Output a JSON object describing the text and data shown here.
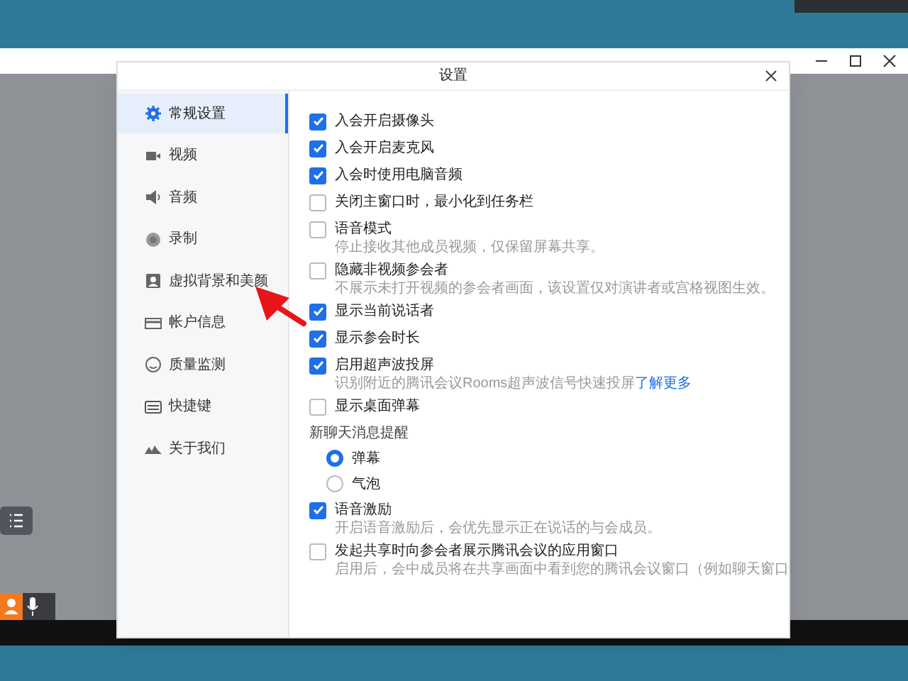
{
  "dialog": {
    "title": "设置"
  },
  "sidebar": {
    "items": [
      {
        "label": "常规设置",
        "selected": true
      },
      {
        "label": "视频",
        "selected": false
      },
      {
        "label": "音频",
        "selected": false
      },
      {
        "label": "录制",
        "selected": false
      },
      {
        "label": "虚拟背景和美颜",
        "selected": false
      },
      {
        "label": "帐户信息",
        "selected": false
      },
      {
        "label": "质量监测",
        "selected": false
      },
      {
        "label": "快捷键",
        "selected": false
      },
      {
        "label": "关于我们",
        "selected": false
      }
    ]
  },
  "settings": [
    {
      "kind": "checkbox",
      "label": "入会开启摄像头",
      "checked": true
    },
    {
      "kind": "checkbox",
      "label": "入会开启麦克风",
      "checked": true
    },
    {
      "kind": "checkbox",
      "label": "入会时使用电脑音频",
      "checked": true
    },
    {
      "kind": "checkbox",
      "label": "关闭主窗口时，最小化到任务栏",
      "checked": false
    },
    {
      "kind": "checkbox",
      "label": "语音模式",
      "checked": false,
      "description": "停止接收其他成员视频，仅保留屏幕共享。"
    },
    {
      "kind": "checkbox",
      "label": "隐藏非视频参会者",
      "checked": false,
      "description": "不展示未打开视频的参会者画面，该设置仅对演讲者或宫格视图生效。"
    },
    {
      "kind": "checkbox",
      "label": "显示当前说话者",
      "checked": true
    },
    {
      "kind": "checkbox",
      "label": "显示参会时长",
      "checked": true
    },
    {
      "kind": "checkbox",
      "label": "启用超声波投屏",
      "checked": true,
      "description": "识别附近的腾讯会议Rooms超声波信号快速投屏",
      "link": "了解更多"
    },
    {
      "kind": "checkbox",
      "label": "显示桌面弹幕",
      "checked": false
    },
    {
      "kind": "heading",
      "label": "新聊天消息提醒"
    },
    {
      "kind": "radio",
      "label": "弹幕",
      "selected": true
    },
    {
      "kind": "radio",
      "label": "气泡",
      "selected": false
    },
    {
      "kind": "checkbox",
      "label": "语音激励",
      "checked": true,
      "description": "开启语音激励后，会优先显示正在说话的与会成员。"
    },
    {
      "kind": "checkbox",
      "label": "发起共享时向参会者展示腾讯会议的应用窗口",
      "checked": false,
      "description": "启用后，会中成员将在共享画面中看到您的腾讯会议窗口（例如聊天窗口"
    }
  ]
}
